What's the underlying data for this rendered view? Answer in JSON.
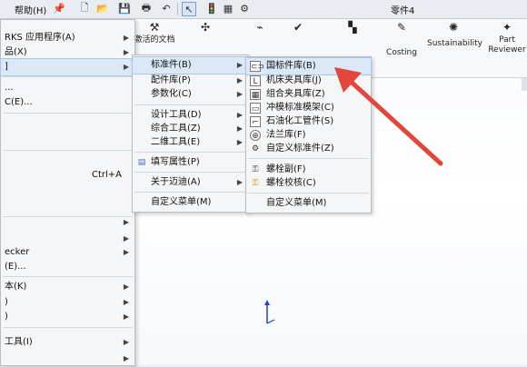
{
  "menubar": {
    "help_label": "帮助(H)",
    "document_title": "零件4"
  },
  "ribbon": {
    "buttons": [
      {
        "label": "激活的文档",
        "icon": "activate-doc-icon"
      },
      {
        "label": "Costing",
        "icon": "costing-icon"
      },
      {
        "label": "Sustainability",
        "icon": "sustainability-icon"
      },
      {
        "label": "Part\nReviewer",
        "icon": "part-reviewer-icon"
      }
    ]
  },
  "main_menu": {
    "items": [
      {
        "label": "RKS 应用程序(A)",
        "submenu": true
      },
      {
        "label": "品(X)",
        "submenu": true
      },
      {
        "label": "",
        "submenu": true,
        "highlighted": true
      },
      {
        "label": "..."
      },
      {
        "label": "C(E)..."
      },
      {
        "label": ""
      },
      {
        "label": "Ctrl+A",
        "is_shortcut_only": true
      },
      {
        "label": ""
      },
      {
        "label": "",
        "submenu": true
      },
      {
        "label": "",
        "submenu": true
      },
      {
        "label": "ecker",
        "submenu": true
      },
      {
        "label": "(E)..."
      },
      {
        "label": "本(K)",
        "submenu": true
      },
      {
        "label": ")",
        "submenu": true
      },
      {
        "label": ")",
        "submenu": true
      },
      {
        "label": "工具(I)",
        "submenu": true
      },
      {
        "label": "",
        "submenu": true
      }
    ]
  },
  "sub_menu": {
    "items": [
      {
        "label": "标准件(B)",
        "submenu": true,
        "highlighted": true
      },
      {
        "label": "配件库(P)",
        "submenu": true
      },
      {
        "label": "参数化(C)",
        "submenu": true
      },
      {
        "label": "设计工具(D)",
        "submenu": true
      },
      {
        "label": "综合工具(Z)",
        "submenu": true
      },
      {
        "label": "二维工具(E)",
        "submenu": true
      },
      {
        "label": "填写属性(P)"
      },
      {
        "label": "关于迈迪(A)",
        "submenu": true
      },
      {
        "label": "自定义菜单(M)"
      }
    ]
  },
  "standard_menu": {
    "items": [
      {
        "label": "国标件库(B)",
        "icon": "bolt-icon",
        "highlighted": true
      },
      {
        "label": "机床夹具库(J)",
        "icon": "fixture-icon"
      },
      {
        "label": "组合夹具库(Z)",
        "icon": "combo-fixture-icon"
      },
      {
        "label": "冲模标准模架(C)",
        "icon": "die-frame-icon"
      },
      {
        "label": "石油化工管件(S)",
        "icon": "pipe-icon"
      },
      {
        "label": "法兰库(F)",
        "icon": "flange-icon"
      },
      {
        "label": "自定义标准件(Z)",
        "icon": "custom-part-icon"
      },
      {
        "label": "螺栓副(F)",
        "icon": "bolt-pair-icon"
      },
      {
        "label": "螺栓校核(C)",
        "icon": "bolt-check-icon"
      },
      {
        "label": "自定义菜单(M)",
        "icon": ""
      }
    ]
  },
  "colors": {
    "accent_red": "#e2463a",
    "highlight_bg": "#dbe8f7"
  }
}
